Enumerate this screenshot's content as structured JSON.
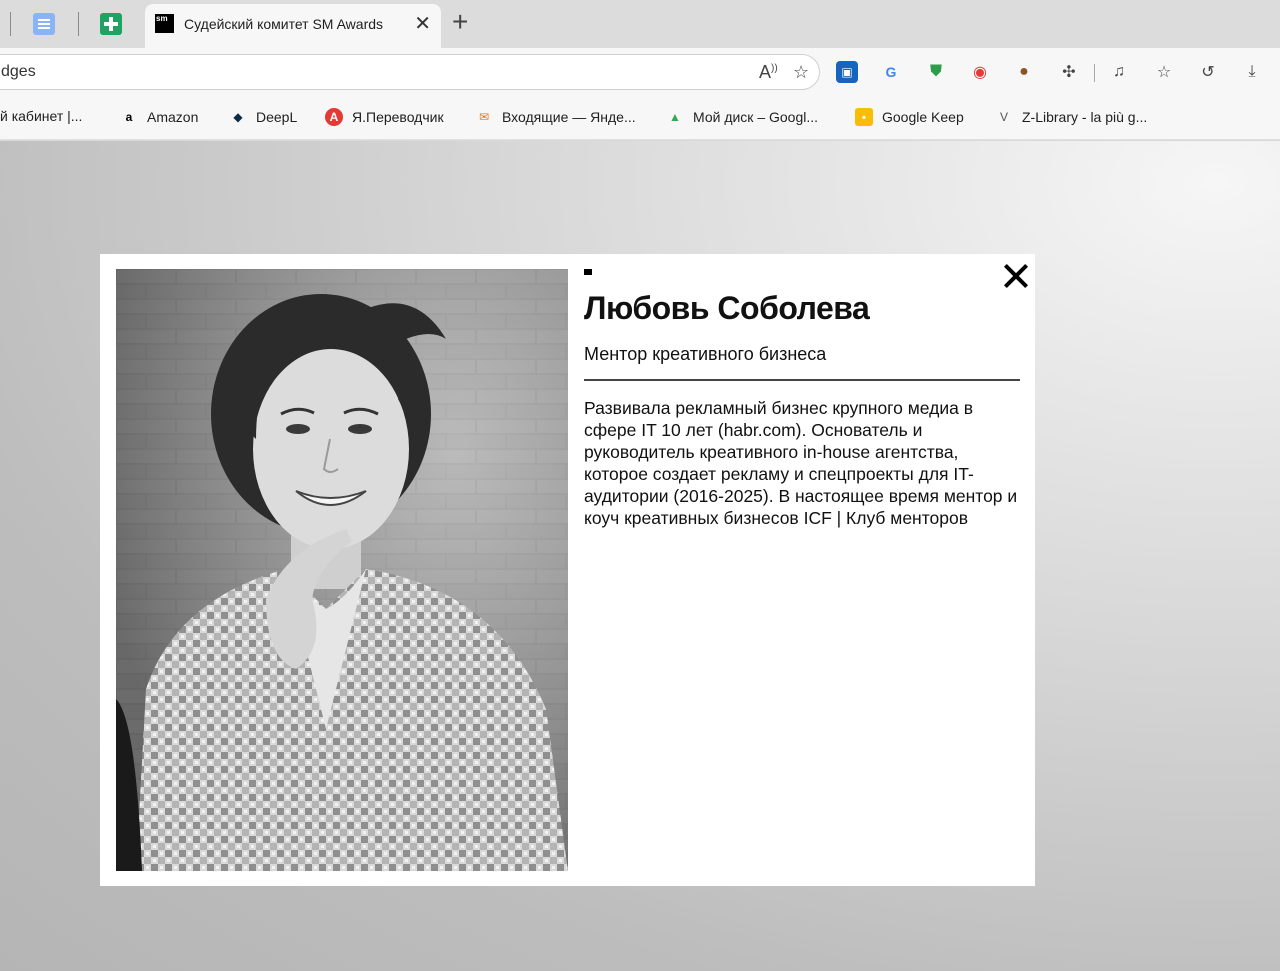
{
  "tabs": {
    "active_title": "Судейский комитет SM Awards",
    "favicon_text": "sm"
  },
  "address": {
    "url_fragment": "dges"
  },
  "bookmarks": [
    {
      "label": "й кабинет |...",
      "icon": "",
      "color": "#f7f7f7"
    },
    {
      "label": "Amazon",
      "icon": "a",
      "color": "#ffffff"
    },
    {
      "label": "DeepL",
      "icon": "◆",
      "color": "#0f2b46"
    },
    {
      "label": "Я.Переводчик",
      "icon": "A",
      "color": "#e53935"
    },
    {
      "label": "Входящие — Янде...",
      "icon": "✉",
      "color": "#ff6f00"
    },
    {
      "label": "Мой диск – Googl...",
      "icon": "▲",
      "color": "#34a853"
    },
    {
      "label": "Google Keep",
      "icon": "▪",
      "color": "#fbbc04"
    },
    {
      "label": "Z-Library - la più g...",
      "icon": "V",
      "color": "#f7f7f7"
    }
  ],
  "modal": {
    "name": "Любовь Соболева",
    "role": "Ментор креативного бизнеса",
    "bio": "Развивала рекламный бизнес крупного медиа в сфере IT 10 лет (habr.com). Основатель и руководитель креативного in-house агентства, которое создает рекламу и спецпроекты для IT-аудитории (2016-2025). В настоящее время ментор и коуч креативных бизнесов ICF | Клуб менторов"
  },
  "colors": {
    "accent_green": "#1ea362",
    "modal_bg": "#ffffff",
    "text": "#111111"
  }
}
